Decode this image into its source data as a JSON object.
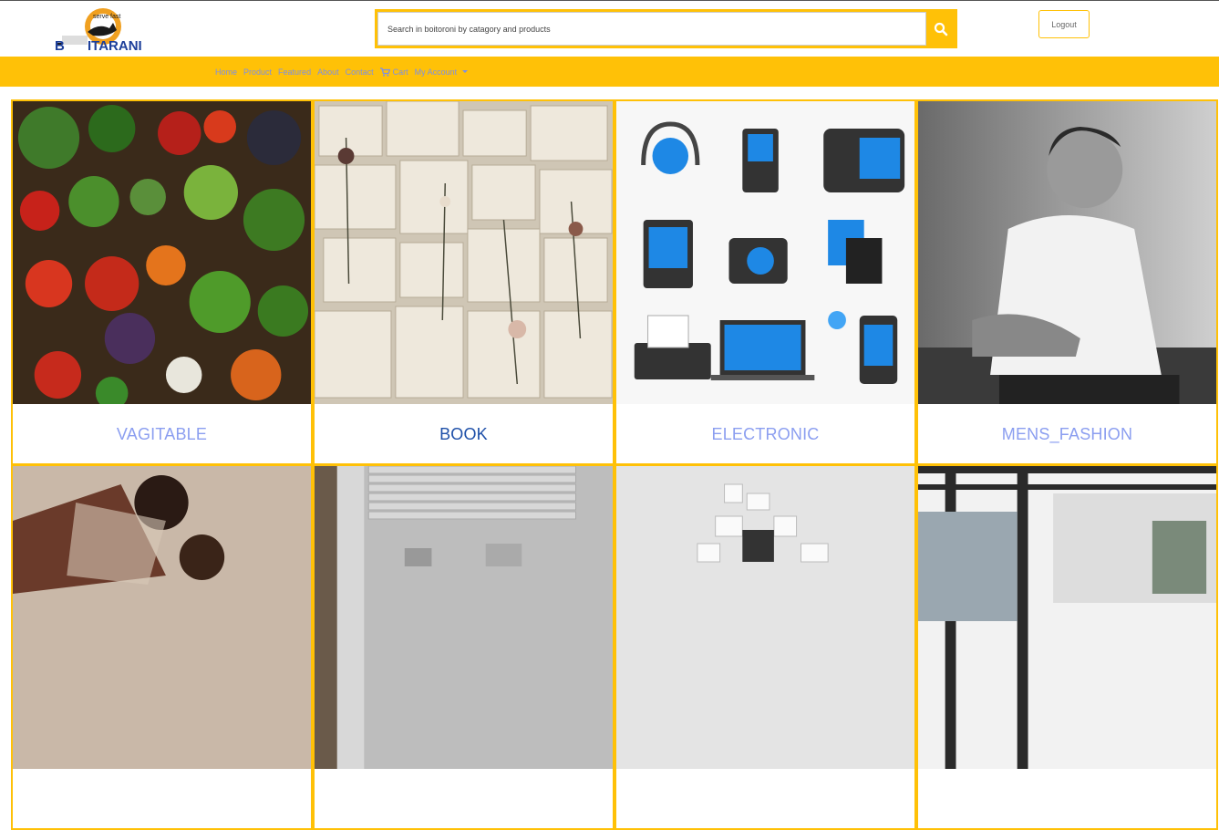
{
  "brand": {
    "tagline": "serve fast",
    "name_b": "B",
    "name_rest": "ITARANI"
  },
  "search": {
    "placeholder": "Search in boitoroni by catagory and products",
    "value": ""
  },
  "header": {
    "logout_label": "Logout"
  },
  "nav": {
    "items": [
      "Home",
      "Product",
      "Featured",
      "About",
      "Contact"
    ],
    "cart_label": "Cart",
    "account_label": "My Account"
  },
  "categories": [
    {
      "title": "VAGITABLE",
      "image": "vegetables-photo"
    },
    {
      "title": "BOOK",
      "image": "books-photo"
    },
    {
      "title": "ELECTRONIC",
      "image": "electronics-photo"
    },
    {
      "title": "MENS_FASHION",
      "image": "mens-fashion-photo"
    },
    {
      "title": "",
      "image": "womens-fashion-photo"
    },
    {
      "title": "",
      "image": "kitchen-photo"
    },
    {
      "title": "",
      "image": "abstract-photo"
    },
    {
      "title": "",
      "image": "house-photo"
    }
  ],
  "colors": {
    "accent": "#ffc107",
    "link": "#7b8fe8",
    "active_title": "#1d4fa8"
  }
}
